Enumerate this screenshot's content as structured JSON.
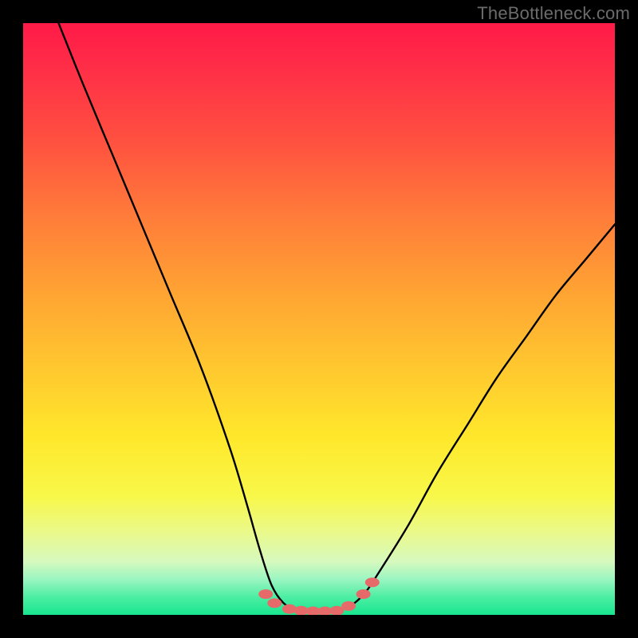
{
  "watermark": {
    "text": "TheBottleneck.com"
  },
  "chart_data": {
    "type": "line",
    "title": "",
    "xlabel": "",
    "ylabel": "",
    "xlim": [
      0,
      100
    ],
    "ylim": [
      0,
      100
    ],
    "series": [
      {
        "name": "bottleneck-curve",
        "x": [
          6,
          10,
          15,
          20,
          25,
          30,
          35,
          38,
          40,
          42,
          44,
          46,
          48,
          50,
          52,
          54,
          56,
          58,
          60,
          65,
          70,
          75,
          80,
          85,
          90,
          95,
          100
        ],
        "values": [
          100,
          90,
          78,
          66,
          54,
          42,
          28,
          18,
          11,
          5,
          2,
          1,
          0.5,
          0.5,
          0.5,
          1,
          2,
          4,
          7,
          15,
          24,
          32,
          40,
          47,
          54,
          60,
          66
        ]
      }
    ],
    "markers": {
      "name": "flat-section-dots",
      "color": "#e76a6a",
      "points": [
        {
          "x": 41,
          "y": 3.5
        },
        {
          "x": 42.5,
          "y": 2.0
        },
        {
          "x": 45,
          "y": 1.0
        },
        {
          "x": 47,
          "y": 0.7
        },
        {
          "x": 49,
          "y": 0.6
        },
        {
          "x": 51,
          "y": 0.6
        },
        {
          "x": 53,
          "y": 0.7
        },
        {
          "x": 55,
          "y": 1.5
        },
        {
          "x": 57.5,
          "y": 3.5
        },
        {
          "x": 59,
          "y": 5.5
        }
      ]
    }
  }
}
